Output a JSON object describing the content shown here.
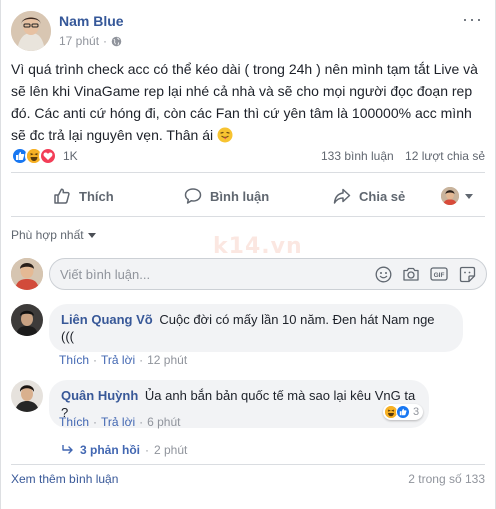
{
  "post": {
    "author": "Nam Blue",
    "time": "17 phút",
    "privacy_icon": "globe-icon",
    "text": "Vì quá trình check acc có thể kéo dài ( trong 24h ) nên mình tạm tắt Live và sẽ lên khi VinaGame rep lại nhé cả nhà và sẽ cho mọi người đọc đoạn rep đó. Các anti cứ hóng đi, còn các Fan thì cứ yên tâm là 100000% acc mình sẽ đc trả lại nguyên vẹn. Thân ái",
    "reaction_count": "1K",
    "comment_count": "133 bình luận",
    "share_count": "12 lượt chia sẻ"
  },
  "actions": {
    "like": "Thích",
    "comment": "Bình luận",
    "share": "Chia sẻ"
  },
  "sort_label": "Phù hợp nhất",
  "watermark": "k14.vn",
  "composer": {
    "placeholder": "Viết bình luận..."
  },
  "comments": [
    {
      "name": "Liên Quang Võ",
      "text": "Cuộc đời có mấy lần 10 năm. Đen hát Nam nge (((",
      "like": "Thích",
      "reply": "Trả lời",
      "time": "12 phút"
    },
    {
      "name": "Quân Huỳnh",
      "text": "Ủa anh bắn bản quốc tế mà sao lại kêu VnG ta ?",
      "like": "Thích",
      "reply": "Trả lời",
      "time": "6 phút",
      "reaction_count": "3",
      "replies_label": "3 phản hồi",
      "replies_time": "2 phút"
    }
  ],
  "footer": {
    "more": "Xem thêm bình luận",
    "count": "2 trong số 133"
  },
  "colors": {
    "link": "#365899",
    "like_blue": "#1877f2",
    "love_red": "#f33e58",
    "haha_yellow": "#f7b125"
  }
}
